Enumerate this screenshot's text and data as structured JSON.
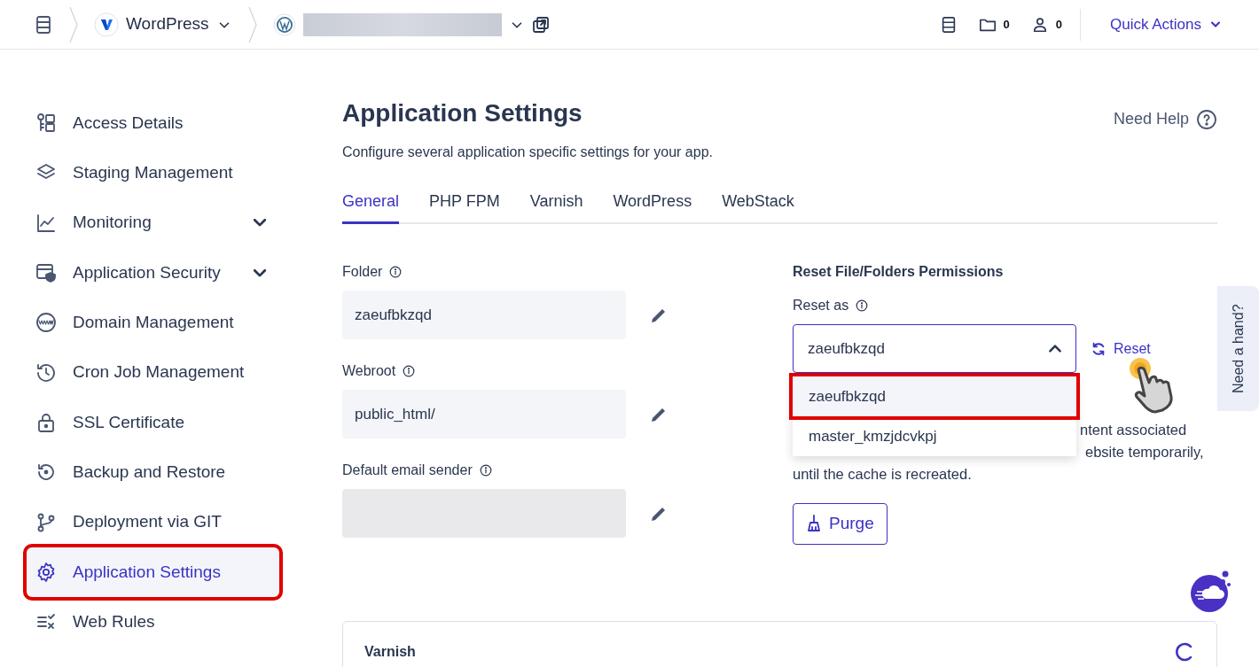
{
  "header": {
    "app_name": "WordPress",
    "counters": [
      {
        "kind": "folder",
        "value": "0"
      },
      {
        "kind": "user",
        "value": "0"
      }
    ],
    "quick_actions": "Quick Actions"
  },
  "sidebar": {
    "items": [
      {
        "label": "Access Details",
        "kind": "access",
        "expandable": false,
        "selected": false,
        "highlighted": false
      },
      {
        "label": "Staging Management",
        "kind": "layers",
        "expandable": false,
        "selected": false,
        "highlighted": false
      },
      {
        "label": "Monitoring",
        "kind": "chart",
        "expandable": true,
        "selected": false,
        "highlighted": false
      },
      {
        "label": "Application Security",
        "kind": "shield",
        "expandable": true,
        "selected": false,
        "highlighted": false
      },
      {
        "label": "Domain Management",
        "kind": "www",
        "expandable": false,
        "selected": false,
        "highlighted": false
      },
      {
        "label": "Cron Job Management",
        "kind": "clock",
        "expandable": false,
        "selected": false,
        "highlighted": false
      },
      {
        "label": "SSL Certificate",
        "kind": "lock",
        "expandable": false,
        "selected": false,
        "highlighted": false
      },
      {
        "label": "Backup and Restore",
        "kind": "restore",
        "expandable": false,
        "selected": false,
        "highlighted": false
      },
      {
        "label": "Deployment via GIT",
        "kind": "git",
        "expandable": false,
        "selected": false,
        "highlighted": false
      },
      {
        "label": "Application Settings",
        "kind": "gear",
        "expandable": false,
        "selected": true,
        "highlighted": true
      },
      {
        "label": "Web Rules",
        "kind": "rules",
        "expandable": false,
        "selected": false,
        "highlighted": false
      }
    ]
  },
  "page": {
    "title": "Application Settings",
    "subtitle": "Configure several application specific settings for your app.",
    "help": "Need Help"
  },
  "tabs": [
    {
      "label": "General",
      "selected": true
    },
    {
      "label": "PHP FPM",
      "selected": false
    },
    {
      "label": "Varnish",
      "selected": false
    },
    {
      "label": "WordPress",
      "selected": false
    },
    {
      "label": "WebStack",
      "selected": false
    }
  ],
  "fields": [
    {
      "label": "Folder",
      "value": "zaeufbkzqd",
      "disabled": false
    },
    {
      "label": "Webroot",
      "value": "public_html/",
      "disabled": false
    },
    {
      "label": "Default email sender",
      "disabled": true
    }
  ],
  "permissions": {
    "title": "Reset File/Folders Permissions",
    "label": "Reset as",
    "select": {
      "value": "zaeufbkzqd",
      "expanded": true
    },
    "reset": "Reset",
    "options": [
      {
        "label": "zaeufbkzqd",
        "selected": true,
        "highlighted": true
      },
      {
        "label": "master_kmzjdcvkpj",
        "selected": false,
        "highlighted": false
      }
    ]
  },
  "purge": {
    "lines": [
      "ntent associated",
      "ebsite temporarily,",
      "until the cache is recreated."
    ],
    "button": "Purge"
  },
  "varnish_card": {
    "title": "Varnish",
    "loading": true
  },
  "help_tab": "Need a hand?"
}
